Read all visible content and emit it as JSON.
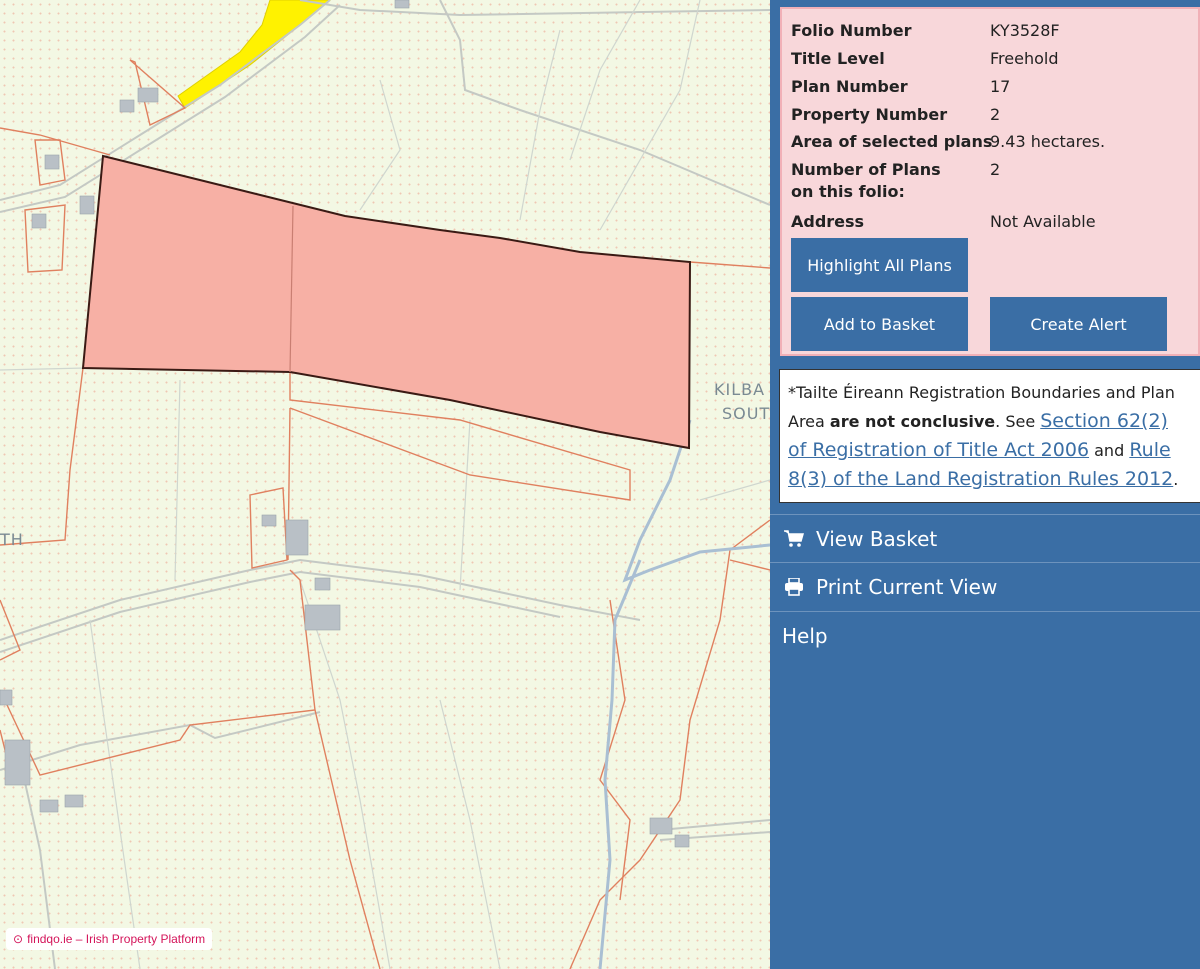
{
  "map": {
    "place_label_1": "KILBA",
    "place_label_2": "SOUT",
    "edge_label": "TH",
    "watermark_text": "findqo.ie – Irish Property Platform",
    "colors": {
      "land": "#f3f8e4",
      "boundary": "#e07a5f",
      "road": "#c8ccc8",
      "selected_fill": "#f6b2a6",
      "selected_outline": "#3a1a14",
      "highlight": "#fff200",
      "river": "#9db8cf"
    }
  },
  "folio": {
    "rows": [
      {
        "key": "Folio Number",
        "value": "KY3528F"
      },
      {
        "key": "Title Level",
        "value": "Freehold"
      },
      {
        "key": "Plan Number",
        "value": "17"
      },
      {
        "key": "Property Number",
        "value": "2"
      },
      {
        "key": "Area of selected plans",
        "value": "9.43 hectares."
      },
      {
        "key": "Number of Plans on this folio:",
        "value": "2"
      },
      {
        "key": "Address",
        "value": "Not Available"
      }
    ],
    "buttons": {
      "highlight_all": "Highlight All Plans",
      "add_to_basket": "Add to Basket",
      "create_alert": "Create Alert"
    }
  },
  "disclaimer": {
    "prefix": "*Tailte Éireann Registration Boundaries and Plan Area ",
    "bold": "are not conclusive",
    "mid": ". See ",
    "link1": "Section 62(2) of Registration of Title Act 2006",
    "and": " and ",
    "link2": "Rule 8(3) of the Land Registration Rules 2012",
    "end": "."
  },
  "nav": {
    "view_basket": "View Basket",
    "print_view": "Print Current View",
    "help": "Help"
  },
  "colors": {
    "panel_blue": "#3a6ea5",
    "folio_bg": "#f8d7da"
  }
}
